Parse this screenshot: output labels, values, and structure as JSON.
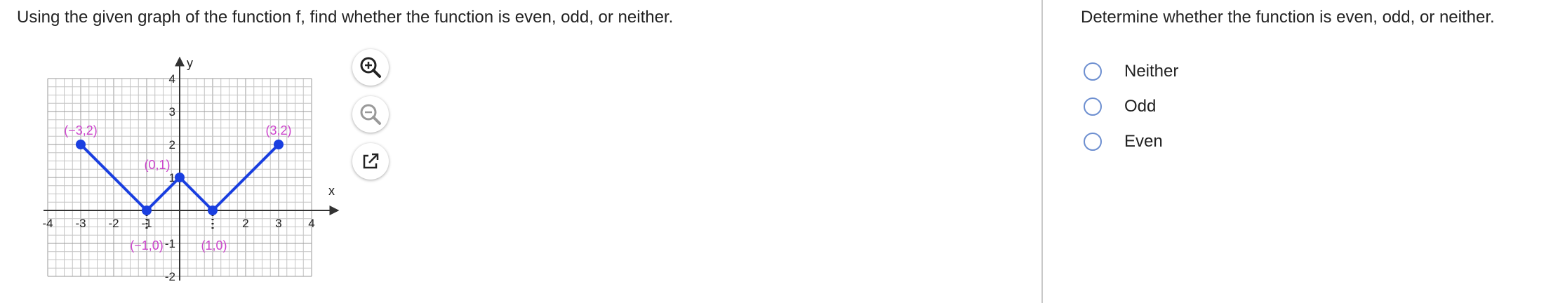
{
  "left": {
    "prompt": "Using the given graph of the function f, find whether the function is even, odd, or neither."
  },
  "graph": {
    "x_axis_label": "x",
    "y_axis_label": "y",
    "x_tick_labels": [
      "-4",
      "-3",
      "-2",
      "-1",
      "2",
      "3",
      "4"
    ],
    "y_tick_labels": [
      "4",
      "3",
      "2",
      "1",
      "-1",
      "-2"
    ],
    "points": [
      {
        "label": "(−3,2)",
        "x": -3,
        "y": 2
      },
      {
        "label": "(−1,0)",
        "x": -1,
        "y": 0
      },
      {
        "label": "(0,1)",
        "x": 0,
        "y": 1
      },
      {
        "label": "(1,0)",
        "x": 1,
        "y": 0
      },
      {
        "label": "(3,2)",
        "x": 3,
        "y": 2
      }
    ],
    "x_range": [
      -4,
      4
    ],
    "y_range": [
      -2,
      4
    ],
    "line_color": "#1a3fe0",
    "label_color": "#cc44cc",
    "grid": true
  },
  "tools": {
    "zoom_in_icon": "zoom-in-icon",
    "zoom_out_icon": "zoom-out-icon",
    "popout_icon": "external-link-icon"
  },
  "right": {
    "question": "Determine whether the function is even, odd, or neither.",
    "options": [
      "Neither",
      "Odd",
      "Even"
    ],
    "selected": null
  },
  "colors": {
    "radio_border": "#6d8fd0",
    "divider": "#c9c9c9"
  }
}
